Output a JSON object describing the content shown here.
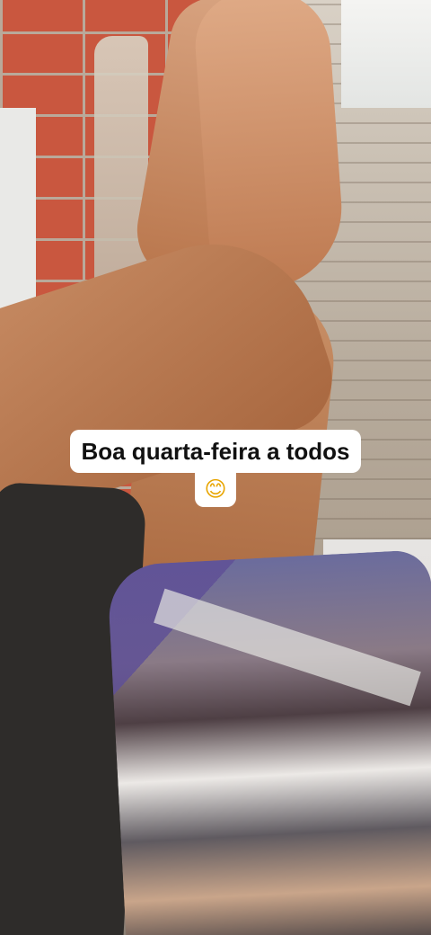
{
  "caption": {
    "line1": "Boa quarta-feira a todos",
    "line2": "😊"
  }
}
